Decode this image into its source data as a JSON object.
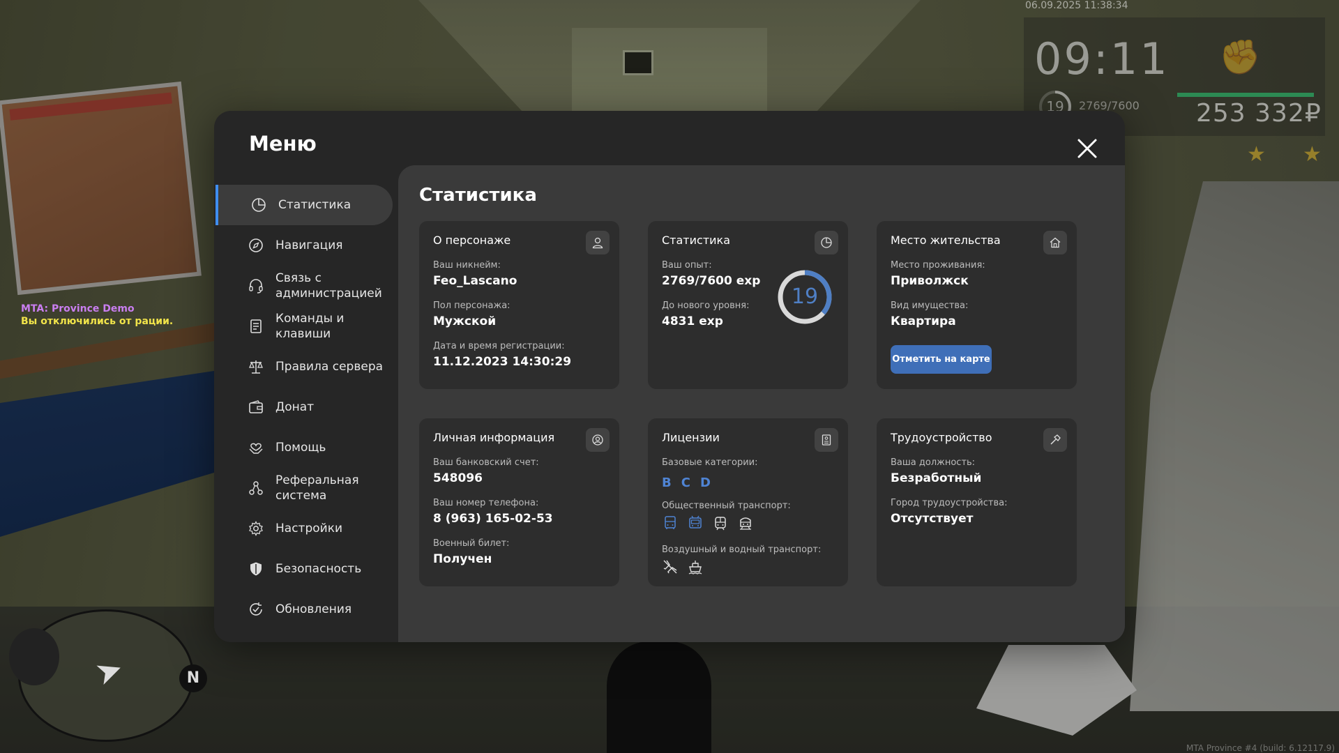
{
  "hud": {
    "datetime": "06.09.2025 11:38:34",
    "time": "09:11",
    "level": "19",
    "exp": "2769/7600",
    "exp_fraction": 0.36,
    "money": "253 332₽",
    "stamina_fraction": 1.0
  },
  "chat": {
    "line1": "MTA: Province Demo",
    "line2": "Вы отключились от рации."
  },
  "build": "MTA Province #4 (build: 6.12117.9)",
  "radar": {
    "north": "N"
  },
  "menu": {
    "title": "Меню",
    "nav": [
      {
        "label": "Статистика",
        "icon": "pie-chart-icon"
      },
      {
        "label": "Навигация",
        "icon": "compass-icon"
      },
      {
        "label": "Связь с администрацией",
        "icon": "headset-icon"
      },
      {
        "label": "Команды и клавиши",
        "icon": "document-icon"
      },
      {
        "label": "Правила сервера",
        "icon": "scales-icon"
      },
      {
        "label": "Донат",
        "icon": "wallet-icon"
      },
      {
        "label": "Помощь",
        "icon": "heart-hands-icon"
      },
      {
        "label": "Реферальная система",
        "icon": "network-icon"
      },
      {
        "label": "Настройки",
        "icon": "gear-icon"
      },
      {
        "label": "Безопасность",
        "icon": "shield-icon"
      },
      {
        "label": "Обновления",
        "icon": "refresh-check-icon"
      }
    ],
    "content_title": "Статистика",
    "cards": {
      "character": {
        "title": "О персонаже",
        "nick_label": "Ваш никнейм:",
        "nick": "Feo_Lascano",
        "gender_label": "Пол персонажа:",
        "gender": "Мужской",
        "reg_label": "Дата и время регистрации:",
        "reg": "11.12.2023 14:30:29"
      },
      "stats": {
        "title": "Статистика",
        "exp_label": "Ваш опыт:",
        "exp": "2769/7600 exp",
        "next_label": "До нового уровня:",
        "next": "4831 exp",
        "level": "19",
        "progress": 0.364
      },
      "residence": {
        "title": "Место жительства",
        "place_label": "Место проживания:",
        "place": "Приволжск",
        "type_label": "Вид имущества:",
        "type": "Квартира",
        "button": "Отметить на карте"
      },
      "personal": {
        "title": "Личная информация",
        "bank_label": "Ваш банковский счет:",
        "bank": "548096",
        "phone_label": "Ваш номер телефона:",
        "phone": "8 (963) 165-02-53",
        "military_label": "Военный билет:",
        "military": "Получен"
      },
      "licenses": {
        "title": "Лицензии",
        "base_label": "Базовые категории:",
        "categories": [
          "B",
          "C",
          "D"
        ],
        "public_label": "Общественный транспорт:",
        "air_label": "Воздушный и водный транспорт:"
      },
      "job": {
        "title": "Трудоустройство",
        "position_label": "Ваша должность:",
        "position": "Безработный",
        "city_label": "Город трудоустройства:",
        "city": "Отсутствует"
      }
    }
  },
  "colors": {
    "accent": "#3f8ef0",
    "button": "#3f6fb8",
    "level_ring": "#4f7fc4",
    "license": "#4f84d4"
  }
}
